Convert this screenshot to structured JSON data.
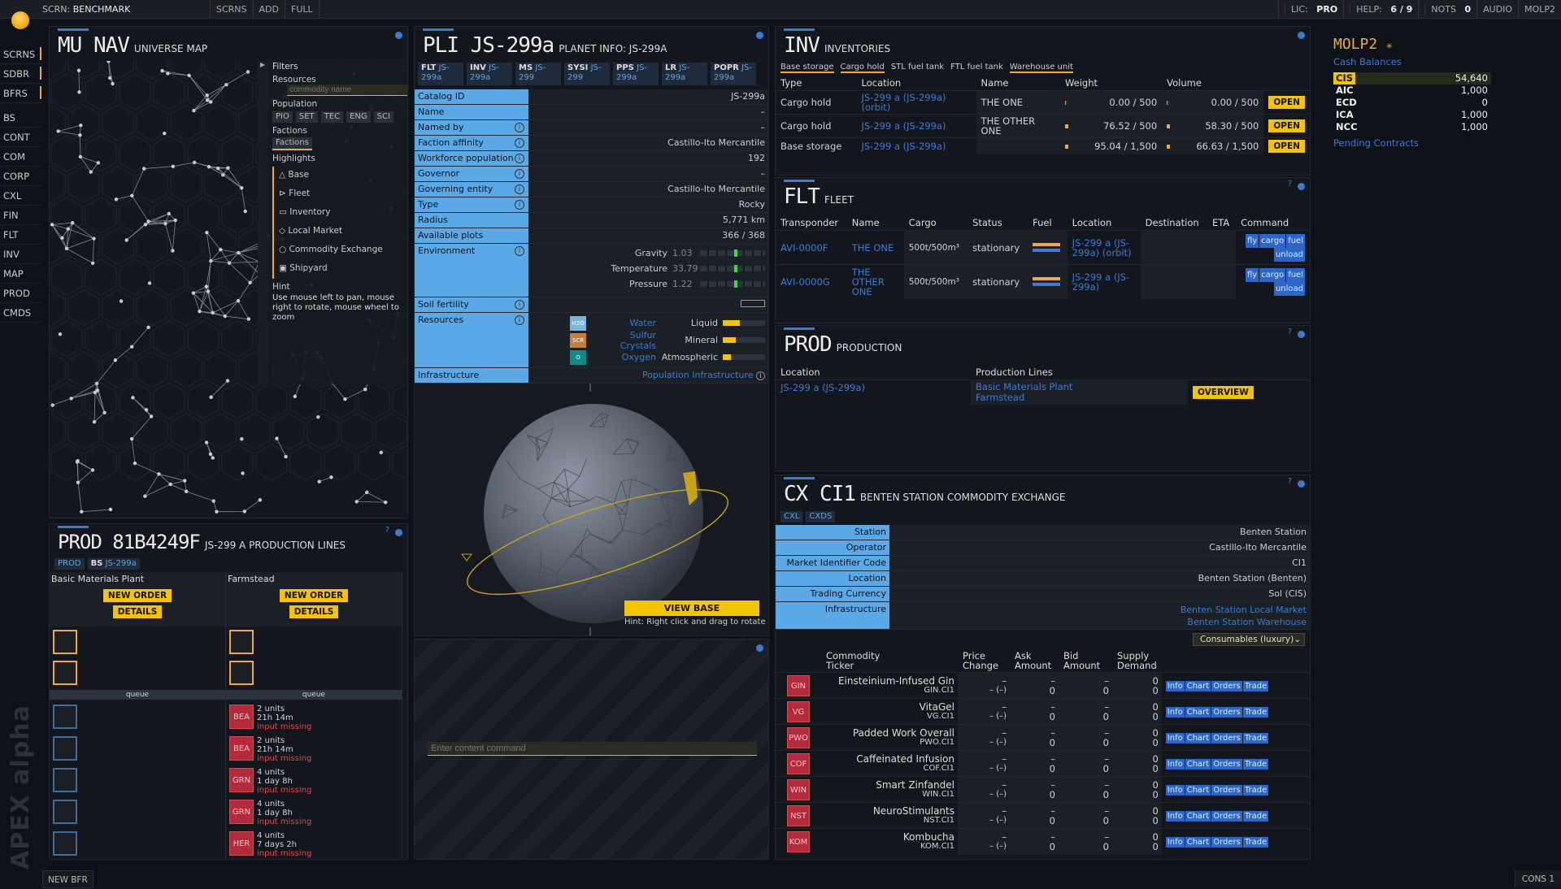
{
  "topbar": {
    "screen_label": "SCRN:",
    "screen_name": "BENCHMARK",
    "buttons": [
      "SCRNS",
      "ADD",
      "FULL"
    ],
    "right": {
      "lic_label": "LIC:",
      "lic": "PRO",
      "help_label": "HELP:",
      "help": "6 / 9",
      "nots_label": "NOTS",
      "nots": "0",
      "audio": "AUDIO",
      "user": "MOLP2"
    }
  },
  "sidenav": {
    "top": [
      "SCRNS",
      "SDBR",
      "BFRS"
    ],
    "main": [
      "BS",
      "CONT",
      "COM",
      "CORP",
      "CXL",
      "FIN",
      "FLT",
      "INV",
      "MAP",
      "PROD",
      "CMDS"
    ]
  },
  "brand": "APEX alpha",
  "bottom": {
    "left": "NEW BFR",
    "right": "CONS 1"
  },
  "mu": {
    "code": "MU NAV",
    "title": "UNIVERSE MAP",
    "filters": "Filters",
    "resources": "Resources",
    "resource_placeholder": "commodity name",
    "population": "Population",
    "pop_buttons": [
      "PIO",
      "SET",
      "TEC",
      "ENG",
      "SCI"
    ],
    "factions": "Factions",
    "factions_btn": "Factions",
    "highlights": "Highlights",
    "highlight_items": [
      "Base",
      "Fleet",
      "Inventory",
      "Local Market",
      "Commodity Exchange",
      "Shipyard"
    ],
    "hint_label": "Hint",
    "hint": "Use mouse left to pan, mouse right to rotate, mouse wheel to zoom"
  },
  "prodlines": {
    "code": "PROD 81B4249F",
    "title": "JS-299 A PRODUCTION LINES",
    "tabs": [
      {
        "code": "PROD",
        "value": ""
      },
      {
        "code": "BS",
        "value": "JS-299a"
      }
    ],
    "cols": [
      {
        "name": "Basic Materials Plant",
        "new": "NEW ORDER",
        "details": "DETAILS",
        "queue": "queue",
        "orders": []
      },
      {
        "name": "Farmstead",
        "new": "NEW ORDER",
        "details": "DETAILS",
        "queue": "queue",
        "orders": [
          {
            "ic": "BEA",
            "units": "2 units",
            "time": "21h 14m",
            "status": "input missing"
          },
          {
            "ic": "BEA",
            "units": "2 units",
            "time": "21h 14m",
            "status": "input missing"
          },
          {
            "ic": "GRN",
            "units": "4 units",
            "time": "1 day 8h",
            "status": "input missing"
          },
          {
            "ic": "GRN",
            "units": "4 units",
            "time": "1 day 8h",
            "status": "input missing"
          },
          {
            "ic": "HER",
            "units": "4 units",
            "time": "7 days 2h",
            "status": "input missing"
          }
        ]
      }
    ]
  },
  "pli": {
    "code": "PLI JS-299a",
    "title": "PLANET INFO: JS-299A",
    "tabs": [
      {
        "code": "FLT",
        "value": "JS-299a"
      },
      {
        "code": "INV",
        "value": "JS-299a"
      },
      {
        "code": "MS",
        "value": "JS-299"
      },
      {
        "code": "SYSI",
        "value": "JS-299"
      },
      {
        "code": "PPS",
        "value": "JS-299a"
      },
      {
        "code": "LR",
        "value": "JS-299a"
      },
      {
        "code": "POPR",
        "value": "JS-299a"
      }
    ],
    "rows": [
      {
        "l": "Catalog ID",
        "v": "JS-299a",
        "link": false,
        "i": false
      },
      {
        "l": "Name",
        "v": "–",
        "link": false,
        "i": false
      },
      {
        "l": "Named by",
        "v": "–",
        "link": false,
        "i": true
      },
      {
        "l": "Faction affinity",
        "v": "Castillo-Ito Mercantile",
        "link": true,
        "i": true
      },
      {
        "l": "Workforce population",
        "v": "192",
        "link": true,
        "i": true
      },
      {
        "l": "Governor",
        "v": "–",
        "link": false,
        "i": true
      },
      {
        "l": "Governing entity",
        "v": "Castillo-Ito Mercantile",
        "link": true,
        "i": true
      },
      {
        "l": "Type",
        "v": "Rocky",
        "link": false,
        "i": true
      },
      {
        "l": "Radius",
        "v": "5,771 km",
        "link": false,
        "i": false
      },
      {
        "l": "Available plots",
        "v": "366 / 368",
        "link": false,
        "i": false
      }
    ],
    "env_label": "Environment",
    "env": [
      {
        "k": "Gravity",
        "v": "1.03"
      },
      {
        "k": "Temperature",
        "v": "33.79"
      },
      {
        "k": "Pressure",
        "v": "1.22"
      }
    ],
    "soil": "Soil fertility",
    "resources_label": "Resources",
    "res": [
      {
        "ic": "H2O",
        "name": "Water",
        "kind": "Liquid",
        "fill": 0.4
      },
      {
        "ic": "SCR",
        "name": "Sulfur Crystals",
        "kind": "Mineral",
        "fill": 0.3
      },
      {
        "ic": "O",
        "name": "Oxygen",
        "kind": "Atmospheric",
        "fill": 0.2
      }
    ],
    "infra_label": "Infrastructure",
    "infra": "Population Infrastructure",
    "view_base": "VIEW BASE",
    "view_hint": "Hint: Right click and drag to rotate"
  },
  "cmd": {
    "placeholder": "Enter content command"
  },
  "inv": {
    "code": "INV",
    "title": "INVENTORIES",
    "tabs": [
      "Base storage",
      "Cargo hold",
      "STL fuel tank",
      "FTL fuel tank",
      "Warehouse unit"
    ],
    "headers": [
      "Type",
      "Location",
      "Name",
      "Weight",
      "Volume"
    ],
    "rows": [
      {
        "type": "Cargo hold",
        "loc": "JS-299 a (JS-299a) (orbit)",
        "name": "THE ONE",
        "w": "0.00 / 500",
        "wf": 0,
        "vol": "0.00 / 500",
        "vf": 0,
        "btn": "OPEN"
      },
      {
        "type": "Cargo hold",
        "loc": "JS-299 a (JS-299a)",
        "name": "THE OTHER ONE",
        "w": "76.52 / 500",
        "wf": 0.15,
        "vol": "58.30 / 500",
        "vf": 0.12,
        "btn": "OPEN"
      },
      {
        "type": "Base storage",
        "loc": "JS-299 a (JS-299a)",
        "name": "",
        "w": "95.04 / 1,500",
        "wf": 0.06,
        "vol": "66.63 / 1,500",
        "vf": 0.04,
        "btn": "OPEN"
      }
    ]
  },
  "flt": {
    "code": "FLT",
    "title": "FLEET",
    "headers": [
      "Transponder",
      "Name",
      "Cargo",
      "Status",
      "Fuel",
      "Location",
      "Destination",
      "ETA",
      "Command"
    ],
    "rows": [
      {
        "t": "AVI-0000F",
        "n": "THE ONE",
        "c": "500t/500m³",
        "s": "stationary",
        "loc": "JS-299 a (JS-299a) (orbit)"
      },
      {
        "t": "AVI-0000G",
        "n": "THE OTHER ONE",
        "c": "500t/500m³",
        "s": "stationary",
        "loc": "JS-299 a (JS-299a)"
      }
    ],
    "cmds": [
      "fly",
      "cargo",
      "fuel",
      "unload"
    ]
  },
  "prod": {
    "code": "PROD",
    "title": "PRODUCTION",
    "headers": [
      "Location",
      "Production Lines"
    ],
    "loc": "JS-299 a (JS-299a)",
    "lines": [
      "Basic Materials Plant",
      "Farmstead"
    ],
    "btn": "OVERVIEW"
  },
  "cx": {
    "code": "CX CI1",
    "title": "BENTEN STATION COMMODITY EXCHANGE",
    "tabs": [
      "CXL",
      "CXDS"
    ],
    "rows": [
      {
        "l": "Station",
        "v": "Benten Station",
        "link": true
      },
      {
        "l": "Operator",
        "v": "Castillo-Ito Mercantile",
        "link": false
      },
      {
        "l": "Market Identifier Code",
        "v": "CI1",
        "link": false
      },
      {
        "l": "Location",
        "v": "Benten Station (Benten)",
        "link": true
      },
      {
        "l": "Trading Currency",
        "v": "Sol (CIS)",
        "link": false
      }
    ],
    "infra_label": "Infrastructure",
    "infra": [
      "Benten Station Local Market",
      "Benten Station Warehouse"
    ],
    "select": "Consumables (luxury)",
    "h": {
      "commodity": "Commodity",
      "ticker": "Ticker",
      "price": "Price",
      "change": "Change",
      "ask": "Ask",
      "amount": "Amount",
      "bid": "Bid",
      "supply": "Supply",
      "demand": "Demand"
    },
    "items": [
      {
        "ic": "GIN",
        "name": "Einsteinium-Infused Gin",
        "tk": "GIN.CI1"
      },
      {
        "ic": "VG",
        "name": "VitaGel",
        "tk": "VG.CI1"
      },
      {
        "ic": "PWO",
        "name": "Padded Work Overall",
        "tk": "PWO.CI1"
      },
      {
        "ic": "COF",
        "name": "Caffeinated Infusion",
        "tk": "COF.CI1"
      },
      {
        "ic": "WIN",
        "name": "Smart Zinfandel",
        "tk": "WIN.CI1"
      },
      {
        "ic": "NST",
        "name": "NeuroStimulants",
        "tk": "NST.CI1"
      },
      {
        "ic": "KOM",
        "name": "Kombucha",
        "tk": "KOM.CI1"
      }
    ],
    "dash": "–",
    "change": "– (–)",
    "zero": "0",
    "actions": [
      "Info",
      "Chart",
      "Orders",
      "Trade"
    ]
  },
  "right": {
    "user": "MOLP2",
    "cash": "Cash Balances",
    "balances": [
      {
        "c": "CIS",
        "v": "54,640"
      },
      {
        "c": "AIC",
        "v": "1,000"
      },
      {
        "c": "ECD",
        "v": "0"
      },
      {
        "c": "ICA",
        "v": "1,000"
      },
      {
        "c": "NCC",
        "v": "1,000"
      }
    ],
    "pending": "Pending Contracts"
  }
}
